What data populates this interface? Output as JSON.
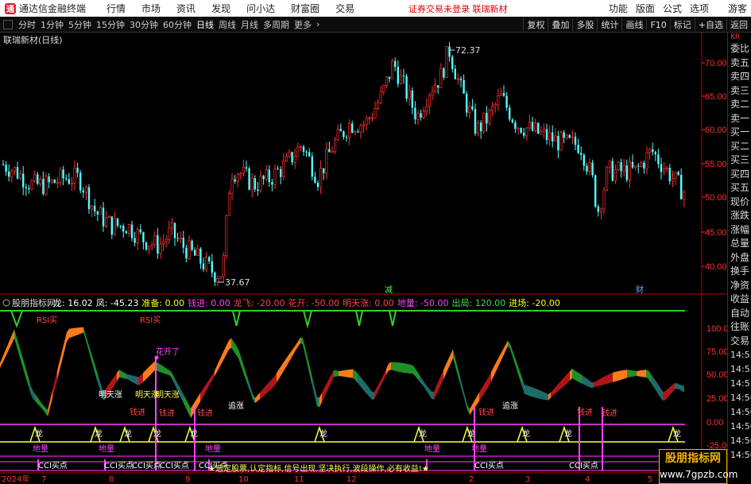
{
  "titlebar": {
    "app_name": "通达信金融终端",
    "menus": [
      "行情",
      "市场",
      "资讯",
      "发现",
      "问小达",
      "财富圈",
      "交易"
    ],
    "notice": "证券交易未登录   联瑞新材",
    "right_menus": [
      "功能",
      "版面",
      "公式",
      "选项"
    ],
    "guest": "游客"
  },
  "toolbar": {
    "periods": [
      "分时",
      "1分钟",
      "5分钟",
      "15分钟",
      "30分钟",
      "60分钟",
      "日线",
      "周线",
      "月线",
      "多周期",
      "更多"
    ],
    "active_period": "日线",
    "tools": [
      "复权",
      "叠加",
      "多股",
      "统计",
      "画线",
      "F10",
      "标记",
      "+自选",
      "返回"
    ]
  },
  "main_chart": {
    "title": "联瑞新材(日线)",
    "price_axis": [
      "70.00",
      "65.00",
      "60.00",
      "55.00",
      "50.00",
      "45.00",
      "40.00"
    ],
    "high_label": "72.37",
    "low_label": "37.67",
    "markers": [
      "减",
      "财"
    ]
  },
  "indicator": {
    "name": "股朋指标网",
    "values": [
      {
        "label": "龙: 16.02",
        "color": "#ffffff"
      },
      {
        "label": "凤: -45.23",
        "color": "#ffffff"
      },
      {
        "label": "准备: 0.00",
        "color": "#ffff00"
      },
      {
        "label": "钱进: 0.00",
        "color": "#ff44ff"
      },
      {
        "label": "龙飞: -20.00",
        "color": "#ff4444"
      },
      {
        "label": "花开: -50.00",
        "color": "#ff4444"
      },
      {
        "label": "明天涨: 0.00",
        "color": "#ff4444"
      },
      {
        "label": "地量: -50.00",
        "color": "#ff44ff"
      },
      {
        "label": "出局: 120.00",
        "color": "#44dd44"
      },
      {
        "label": "进场: -20.00",
        "color": "#ffff00"
      }
    ],
    "axis": [
      "100.00",
      "75.00",
      "50.00",
      "25.00",
      "0.00",
      "-25.00"
    ],
    "labels": {
      "rsi_buy": "RSI买",
      "sell": "卖",
      "bloom": "花开了",
      "tomorrow": "明天涨",
      "money_in": "钱进",
      "chase": "追涨",
      "dragon": "龙",
      "low_volume": "地量",
      "cci_buy": "CCI买点",
      "banner": "★选定股票,认定指标,信号出现,坚决执行,波段操作,必有收益!★"
    }
  },
  "dates": {
    "year": "2024年",
    "months": [
      "7",
      "8",
      "9",
      "10",
      "11",
      "12",
      "2",
      "3",
      "4",
      "5"
    ]
  },
  "sidebar": {
    "kr": "KR",
    "items": [
      "委比",
      "卖五",
      "卖四",
      "卖三",
      "卖二",
      "卖一",
      "买一",
      "买二",
      "买三",
      "买四",
      "买五",
      "现价",
      "涨跌",
      "涨幅",
      "总量",
      "外盘",
      "换手",
      "净资",
      "收益",
      "自动",
      "往账",
      "交易"
    ],
    "times": [
      "14:55",
      "14:55",
      "14:55",
      "14:56",
      "14:56",
      "14:56",
      "14:56",
      "14:56"
    ]
  },
  "watermark": {
    "title": "股朋指标网",
    "url": "www.7gpzb.com"
  },
  "colors": {
    "up": "#ff3030",
    "down": "#54ffff",
    "axis_text": "#ff3030",
    "orange": "#ff7a1a",
    "dark_red": "#b0151a",
    "green": "#1f8f2a",
    "teal": "#1d6b6b"
  }
}
